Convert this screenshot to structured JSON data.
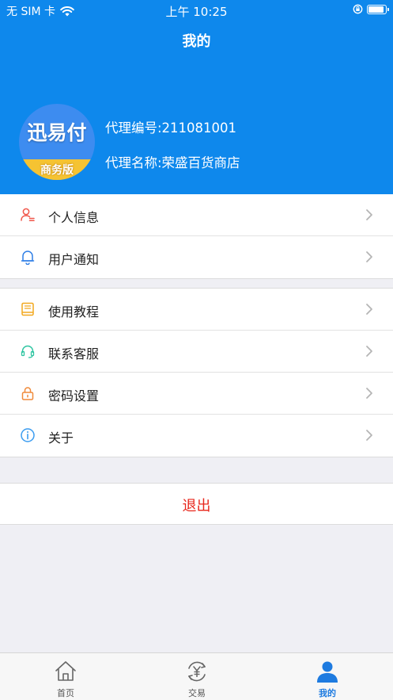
{
  "status_bar": {
    "carrier": "无 SIM 卡",
    "time": "上午 10:25"
  },
  "header": {
    "title": "我的",
    "logo_text": "迅易付",
    "logo_badge": "商务版",
    "agent_id": "代理编号:211081001",
    "agent_name": "代理名称:荣盛百货商店"
  },
  "menu_group_1": [
    {
      "label": "个人信息",
      "icon": "person-icon"
    },
    {
      "label": "用户通知",
      "icon": "bell-icon"
    }
  ],
  "menu_group_2": [
    {
      "label": "使用教程",
      "icon": "book-icon"
    },
    {
      "label": "联系客服",
      "icon": "headset-icon"
    },
    {
      "label": "密码设置",
      "icon": "lock-icon"
    },
    {
      "label": "关于",
      "icon": "info-icon"
    }
  ],
  "logout_label": "退出",
  "tabs": [
    {
      "label": "首页",
      "icon": "home-icon"
    },
    {
      "label": "交易",
      "icon": "yuan-exchange-icon"
    },
    {
      "label": "我的",
      "icon": "user-icon",
      "active": true
    }
  ],
  "colors": {
    "header_bg": "#0e88ec",
    "logout_text": "#e8271c",
    "active_tab": "#1e7be0"
  }
}
